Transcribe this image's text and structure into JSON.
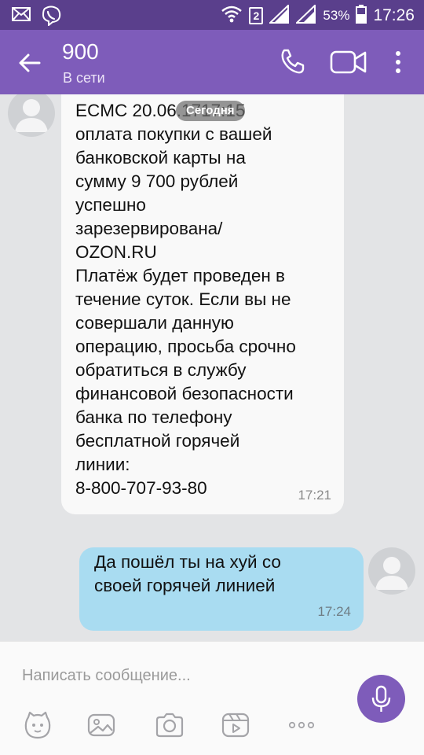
{
  "status_bar": {
    "sim_slot": "2",
    "battery": "53%",
    "time": "17:26"
  },
  "header": {
    "title": "900",
    "status": "В сети"
  },
  "chat": {
    "date_label": "Сегодня",
    "messages": [
      {
        "direction": "incoming",
        "text": "ECMC 20.06.1717:15\nоплата покупки с вашей\nбанковской карты на\nсумму 9 700 рублей\nуспешно\nзарезервирована/\nOZON.RU\nПлатёж будет проведен в\nтечение суток. Если вы не\nсовершали данную\nоперацию, просьба срочно\nобратиться в службу\nфинансовой безопасности\nбанка по телефону\nбесплатной горячей\nлинии:\n8-800-707-93-80",
        "time": "17:21"
      },
      {
        "direction": "outgoing",
        "text": "Да пошёл ты на хуй со\nсвоей горячей линией",
        "time": "17:24"
      }
    ]
  },
  "composer": {
    "placeholder": "Написать сообщение..."
  },
  "colors": {
    "status_bar": "#5a3f8c",
    "app_bar": "#7e5cba",
    "incoming_bubble": "#f9f9f9",
    "outgoing_bubble": "#a9dcf1",
    "accent": "#7e5cba"
  },
  "icons": [
    "mail-icon",
    "viber-icon",
    "wifi-icon",
    "signal-icon",
    "battery-icon",
    "back-arrow-icon",
    "phone-icon",
    "video-camera-icon",
    "more-vert-icon",
    "avatar-icon",
    "microphone-icon",
    "sticker-icon",
    "gallery-icon",
    "camera-icon",
    "gif-icon",
    "more-horiz-icon"
  ]
}
